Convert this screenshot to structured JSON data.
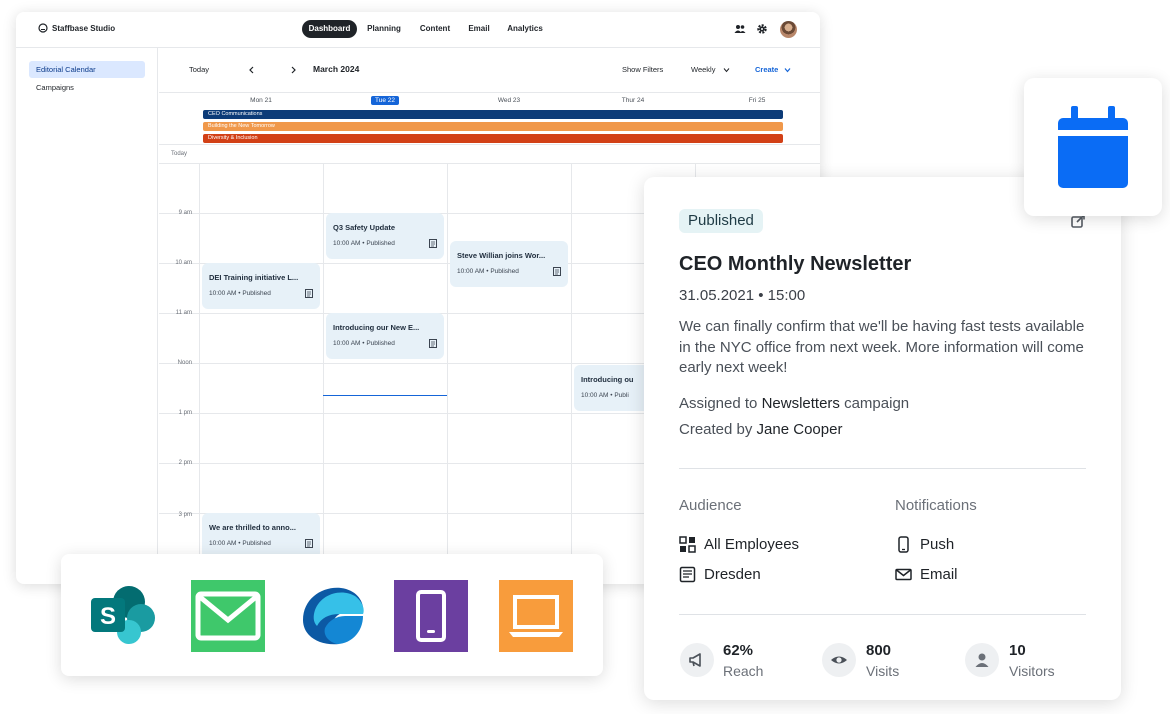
{
  "app": {
    "name": "Staffbase Studio"
  },
  "nav": [
    "Dashboard",
    "Planning",
    "Content",
    "Email",
    "Analytics"
  ],
  "sidebar": [
    "Editorial Calendar",
    "Campaigns"
  ],
  "toolbar": {
    "today": "Today",
    "month": "March 2024",
    "filters": "Show Filters",
    "view": "Weekly",
    "create": "Create"
  },
  "days": [
    "Mon 21",
    "Tue 22",
    "Wed 23",
    "Thur 24",
    "Fri 25"
  ],
  "campaigns": [
    {
      "name": "CEO Communications",
      "color": "#0c3b78"
    },
    {
      "name": "Building the New Tomorrow",
      "color": "#f0984a"
    },
    {
      "name": "Diversity & Inclusion",
      "color": "#d24016"
    }
  ],
  "today_label": "Today",
  "times": [
    "9 am",
    "10 am",
    "11 am",
    "Noon",
    "1 pm",
    "2 pm",
    "3 pm"
  ],
  "events": [
    {
      "title": "Q3 Safety Update",
      "meta": "10:00 AM • Published"
    },
    {
      "title": "Steve Willian joins Wor...",
      "meta": "10:00 AM • Published"
    },
    {
      "title": "DEI Training initiative L...",
      "meta": "10:00 AM • Published"
    },
    {
      "title": "Introducing our New E...",
      "meta": "10:00 AM • Published"
    },
    {
      "title": "Introducing ou",
      "meta": "10:00 AM • Publi"
    },
    {
      "title": "We are thrilled to anno...",
      "meta": "10:00 AM • Published"
    }
  ],
  "detail": {
    "status": "Published",
    "title": "CEO Monthly Newsletter",
    "date": "31.05.2021 • 15:00",
    "description": "We can finally confirm that we'll be having fast tests available in the NYC office from next week. More information will come early next week!",
    "assigned_prefix": "Assigned to ",
    "assigned_campaign": "Newsletters",
    "assigned_suffix": " campaign",
    "created_prefix": "Created by ",
    "created_by": "Jane Cooper",
    "audience_title": "Audience",
    "audience": [
      "All Employees",
      "Dresden"
    ],
    "notifications_title": "Notifications",
    "notifications": [
      "Push",
      "Email"
    ],
    "stats": [
      {
        "value": "62%",
        "label": "Reach"
      },
      {
        "value": "800",
        "label": "Visits"
      },
      {
        "value": "10",
        "label": "Visitors"
      }
    ]
  },
  "colors": {
    "accent": "#1565d8",
    "calendar_icon": "#0a6cf5",
    "event_bg": "#e7f1f8"
  },
  "channels": [
    "sharepoint-icon",
    "email-icon",
    "edge-icon",
    "mobile-app-icon",
    "desktop-icon"
  ]
}
